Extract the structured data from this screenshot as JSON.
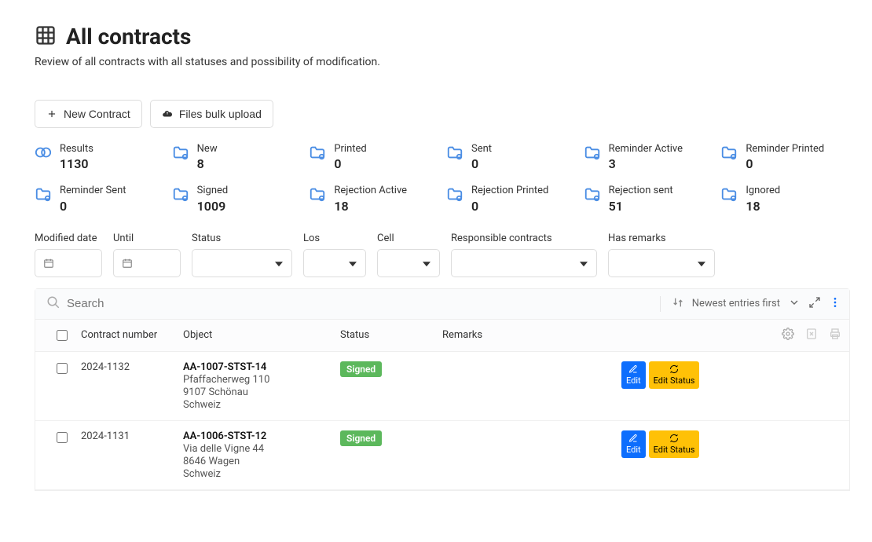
{
  "header": {
    "title": "All contracts",
    "subtitle": "Review of all contracts with all statuses and possibility of modification."
  },
  "actions": {
    "new_contract": "New Contract",
    "bulk_upload": "Files bulk upload"
  },
  "stats": [
    {
      "label": "Results",
      "value": "1130",
      "icon": "results-icon"
    },
    {
      "label": "New",
      "value": "8",
      "icon": "folder-icon"
    },
    {
      "label": "Printed",
      "value": "0",
      "icon": "folder-icon"
    },
    {
      "label": "Sent",
      "value": "0",
      "icon": "folder-icon"
    },
    {
      "label": "Reminder Active",
      "value": "3",
      "icon": "folder-icon"
    },
    {
      "label": "Reminder Printed",
      "value": "0",
      "icon": "folder-icon"
    },
    {
      "label": "Reminder Sent",
      "value": "0",
      "icon": "folder-icon"
    },
    {
      "label": "Signed",
      "value": "1009",
      "icon": "folder-icon"
    },
    {
      "label": "Rejection Active",
      "value": "18",
      "icon": "folder-icon"
    },
    {
      "label": "Rejection Printed",
      "value": "0",
      "icon": "folder-icon"
    },
    {
      "label": "Rejection sent",
      "value": "51",
      "icon": "folder-icon"
    },
    {
      "label": "Ignored",
      "value": "18",
      "icon": "folder-icon"
    }
  ],
  "filters": {
    "modified_date_label": "Modified date",
    "until_label": "Until",
    "status_label": "Status",
    "los_label": "Los",
    "cell_label": "Cell",
    "responsible_label": "Responsible contracts",
    "has_remarks_label": "Has remarks"
  },
  "list": {
    "search_placeholder": "Search",
    "sort_label": "Newest entries first",
    "columns": {
      "contract_number": "Contract number",
      "object": "Object",
      "status": "Status",
      "remarks": "Remarks"
    },
    "status_signed_label": "Signed",
    "edit_label": "Edit",
    "edit_status_label": "Edit Status",
    "rows": [
      {
        "number": "2024-1132",
        "object_name": "AA-1007-STST-14",
        "address": "Pfaffacherweg 110",
        "zip_city": "9107  Schönau",
        "country": "Schweiz",
        "status": "Signed"
      },
      {
        "number": "2024-1131",
        "object_name": "AA-1006-STST-12",
        "address": "Via delle Vigne 44",
        "zip_city": "8646  Wagen",
        "country": "Schweiz",
        "status": "Signed"
      }
    ]
  }
}
